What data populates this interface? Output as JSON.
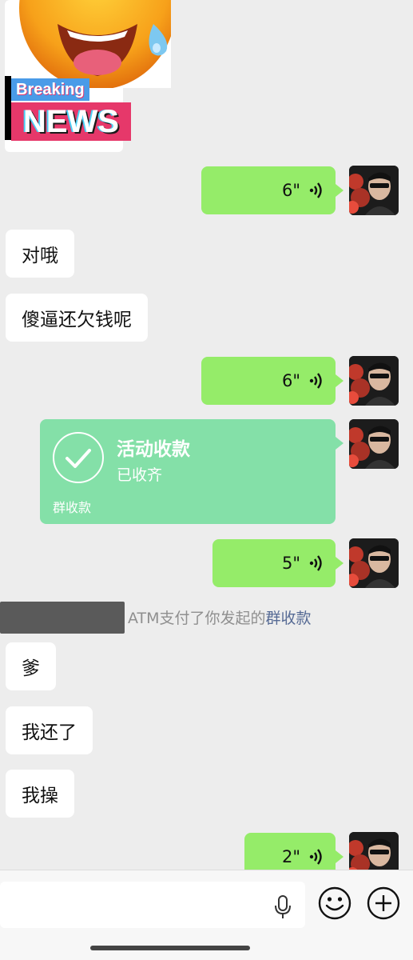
{
  "sticker": {
    "breaking_label": "Breaking",
    "news_label": "NEWS"
  },
  "messages": [
    {
      "side": "right",
      "type": "voice",
      "duration": "6\""
    },
    {
      "side": "left",
      "type": "text",
      "text": "对哦"
    },
    {
      "side": "left",
      "type": "text",
      "text": "傻逼还欠钱呢"
    },
    {
      "side": "right",
      "type": "voice",
      "duration": "6\""
    },
    {
      "side": "right",
      "type": "payment",
      "title": "活动收款",
      "status": "已收齐",
      "footer": "群收款"
    },
    {
      "side": "right",
      "type": "voice",
      "duration": "5\""
    },
    {
      "side": "left",
      "type": "text",
      "text": "爹"
    },
    {
      "side": "left",
      "type": "text",
      "text": "我还了"
    },
    {
      "side": "left",
      "type": "text",
      "text": "我操"
    },
    {
      "side": "right",
      "type": "voice",
      "duration": "2\""
    }
  ],
  "system_notice": {
    "text": "ATM支付了你发起的",
    "link": "群收款"
  },
  "icons": {
    "voice": "voice-wave-icon",
    "mic": "microphone-icon",
    "emoji": "emoji-icon",
    "plus": "plus-circle-icon",
    "check": "check-circle-icon"
  },
  "colors": {
    "background": "#ededed",
    "bubble_right": "#95ec69",
    "bubble_left": "#ffffff",
    "payment_card": "#84e0a8",
    "link": "#576b95"
  }
}
